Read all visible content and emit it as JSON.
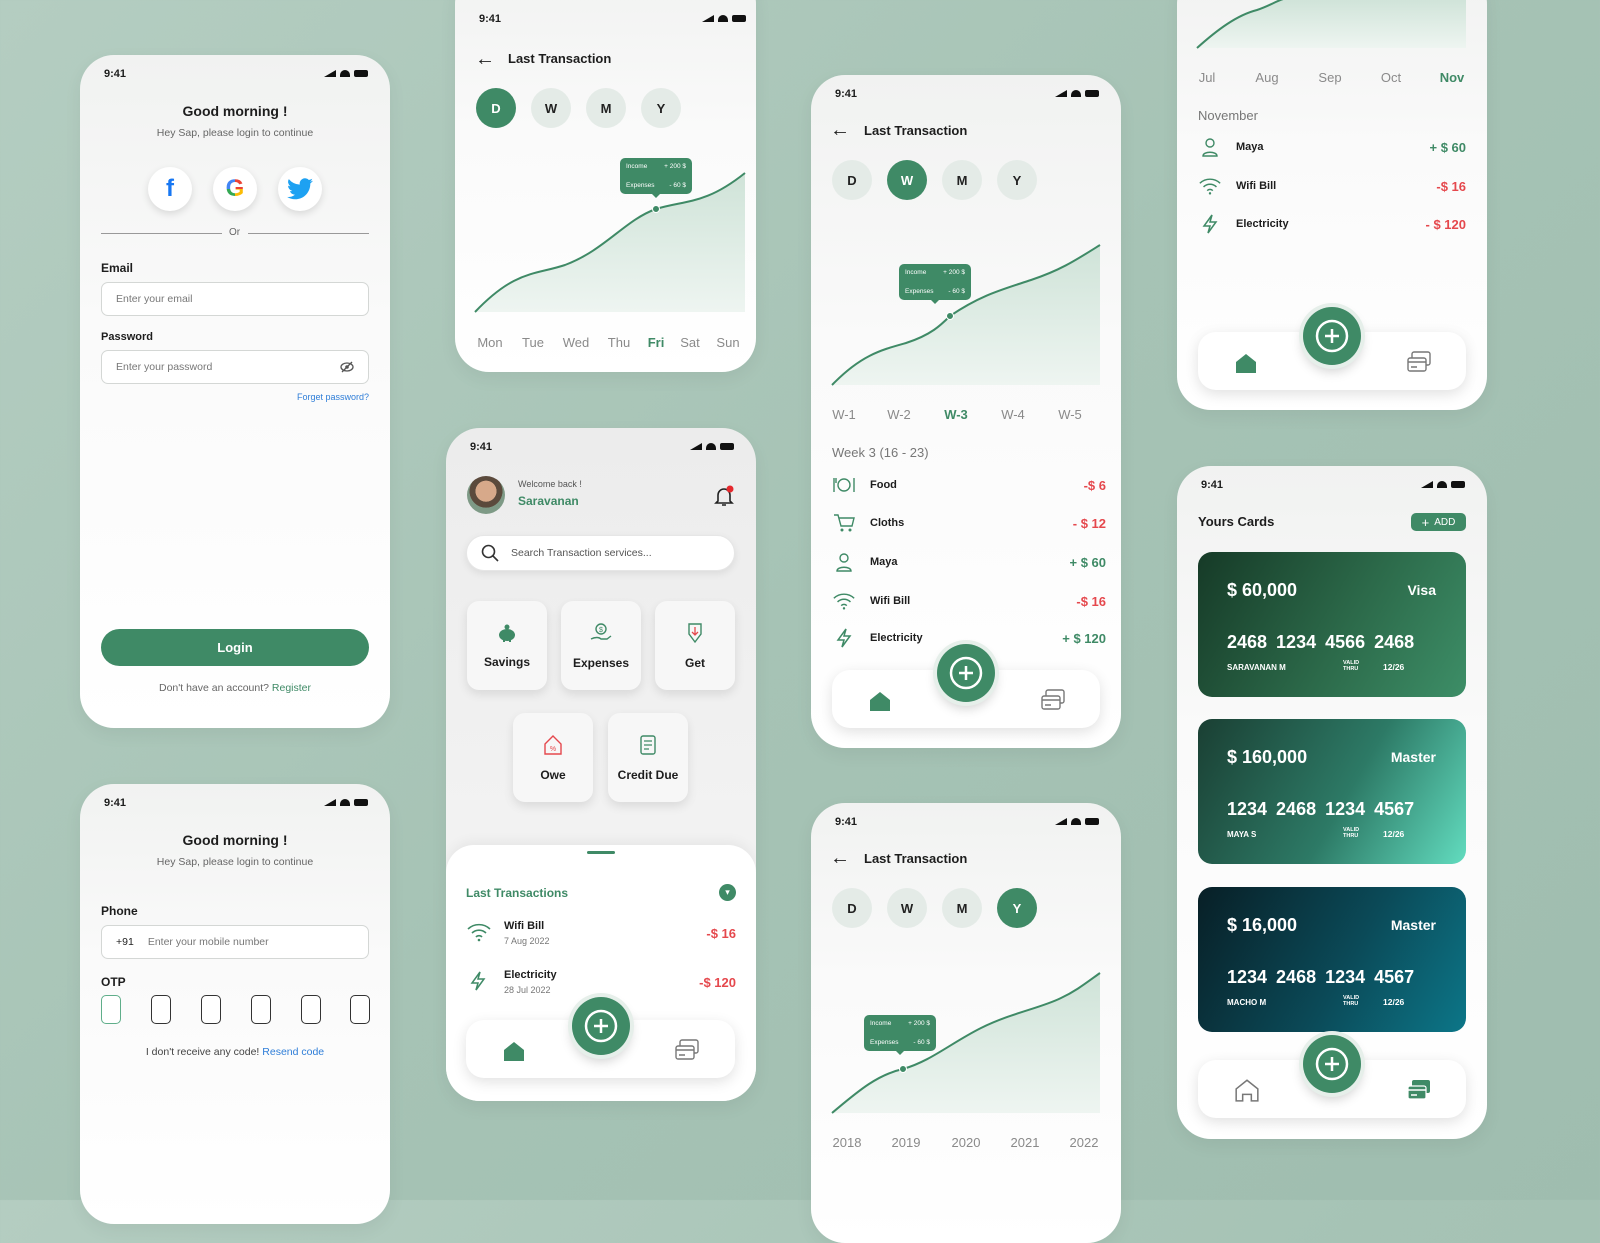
{
  "status": {
    "time": "9:41"
  },
  "colors": {
    "accent": "#3f8a66",
    "negative": "#e5484d",
    "background": "#a9c6b8"
  },
  "login": {
    "greeting": "Good morning !",
    "subtitle": "Hey Sap, please login to continue",
    "social": [
      "facebook-icon",
      "google-icon",
      "twitter-icon"
    ],
    "divider": "Or",
    "email_label": "Email",
    "email_placeholder": "Enter your email",
    "password_label": "Password",
    "password_placeholder": "Enter your password",
    "forgot": "Forget password?",
    "login_button": "Login",
    "no_account": "Don't have an account?",
    "register": "Register"
  },
  "otp": {
    "greeting": "Good morning !",
    "subtitle": "Hey Sap, please login to continue",
    "phone_label": "Phone",
    "country_code": "+91",
    "phone_placeholder": "Enter your mobile number",
    "otp_label": "OTP",
    "no_code": "I don't receive any code!",
    "resend": "Resend code"
  },
  "tooltip": {
    "income_label": "Income",
    "income_value": "+ 200 $",
    "expenses_label": "Expenses",
    "expenses_value": "- 60 $"
  },
  "daily": {
    "title": "Last Transaction",
    "periods": [
      "D",
      "W",
      "M",
      "Y"
    ],
    "active_period": "D",
    "x_labels": [
      "Mon",
      "Tue",
      "Wed",
      "Thu",
      "Fri",
      "Sat",
      "Sun"
    ],
    "active_label": "Fri"
  },
  "home": {
    "welcome": "Welcome back !",
    "user": "Saravanan",
    "search_placeholder": "Search Transaction services...",
    "tiles": [
      "Savings",
      "Expenses",
      "Get",
      "Owe",
      "Credit Due"
    ],
    "last_transactions": "Last Transactions",
    "transactions": [
      {
        "name": "Wifi Bill",
        "date": "7 Aug 2022",
        "amount": "-$ 16"
      },
      {
        "name": "Electricity",
        "date": "28 Jul 2022",
        "amount": "-$ 120"
      }
    ]
  },
  "weekly": {
    "title": "Last Transaction",
    "periods": [
      "D",
      "W",
      "M",
      "Y"
    ],
    "active_period": "W",
    "x_labels": [
      "W-1",
      "W-2",
      "W-3",
      "W-4",
      "W-5"
    ],
    "active_label": "W-3",
    "section": "Week 3 (16 - 23)",
    "rows": [
      {
        "name": "Food",
        "amount": "-$ 6",
        "type": "neg"
      },
      {
        "name": "Cloths",
        "amount": "- $ 12",
        "type": "neg"
      },
      {
        "name": "Maya",
        "amount": "+ $ 60",
        "type": "pos"
      },
      {
        "name": "Wifi Bill",
        "amount": "-$ 16",
        "type": "neg"
      },
      {
        "name": "Electricity",
        "amount": "+ $ 120",
        "type": "pos"
      }
    ]
  },
  "yearly": {
    "title": "Last Transaction",
    "periods": [
      "D",
      "W",
      "M",
      "Y"
    ],
    "active_period": "Y",
    "x_labels": [
      "2018",
      "2019",
      "2020",
      "2021",
      "2022"
    ]
  },
  "monthly": {
    "x_labels": [
      "Jul",
      "Aug",
      "Sep",
      "Oct",
      "Nov"
    ],
    "active_label": "Nov",
    "section": "November",
    "rows": [
      {
        "name": "Maya",
        "amount": "+ $ 60",
        "type": "pos"
      },
      {
        "name": "Wifi Bill",
        "amount": "-$ 16",
        "type": "neg"
      },
      {
        "name": "Electricity",
        "amount": "- $ 120",
        "type": "neg"
      }
    ]
  },
  "cards": {
    "title": "Yours Cards",
    "add": "ADD",
    "valid_label": "VALID THRU",
    "items": [
      {
        "amount": "$ 60,000",
        "type": "Visa",
        "number": "2468 1234 4566 2468",
        "owner": "SARAVANAN M",
        "valid": "12/26"
      },
      {
        "amount": "$ 160,000",
        "type": "Master",
        "number": "1234 2468 1234 4567",
        "owner": "MAYA S",
        "valid": "12/26"
      },
      {
        "amount": "$ 16,000",
        "type": "Master",
        "number": "1234 2468 1234 4567",
        "owner": "MACHO M",
        "valid": "12/26"
      }
    ]
  }
}
